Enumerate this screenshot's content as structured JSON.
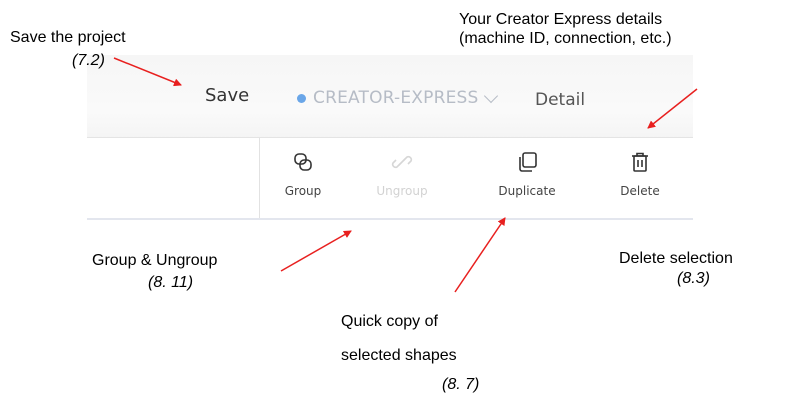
{
  "toolbar": {
    "save_label": "Save",
    "device_name": "CREATOR-EXPRESS",
    "detail_label": "Detail",
    "status_dot_color": "#6aa6e8",
    "tools": [
      {
        "label": "Group",
        "icon": "group-icon",
        "enabled": true
      },
      {
        "label": "Ungroup",
        "icon": "ungroup-icon",
        "enabled": false
      },
      {
        "label": "Duplicate",
        "icon": "duplicate-icon",
        "enabled": true
      },
      {
        "label": "Delete",
        "icon": "delete-icon",
        "enabled": true
      }
    ]
  },
  "annotations": {
    "save": {
      "text": "Save the project",
      "ref": "(7.2)"
    },
    "details": {
      "line1": "Your Creator Express details",
      "line2": "(machine ID, connection, etc.)"
    },
    "group": {
      "text": "Group & Ungroup",
      "ref": "(8. 11)"
    },
    "delete": {
      "text": "Delete selection",
      "ref": "(8.3)"
    },
    "duplicate": {
      "line1": "Quick copy of",
      "line2": "selected shapes",
      "ref": "(8. 7)"
    },
    "arrow_color": "#e8201f"
  }
}
